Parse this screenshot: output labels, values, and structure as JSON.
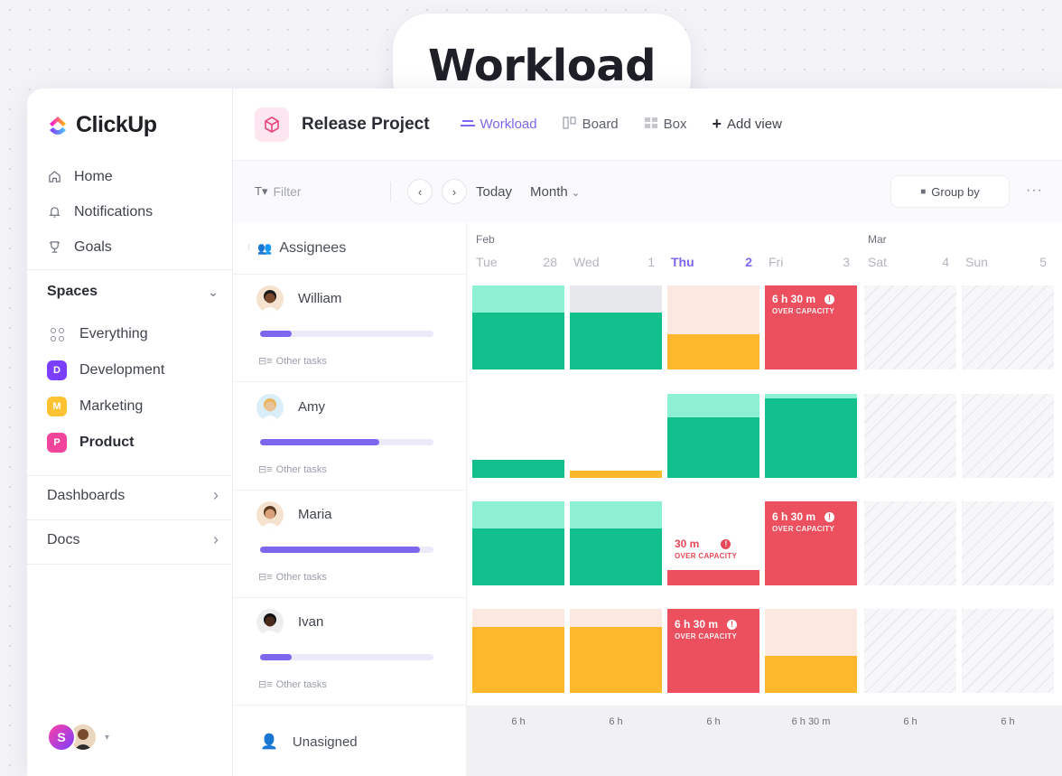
{
  "headline": "Workload",
  "sidebar": {
    "logo": "ClickUp",
    "nav": [
      {
        "label": "Home",
        "icon": "home-icon"
      },
      {
        "label": "Notifications",
        "icon": "bell-icon"
      },
      {
        "label": "Goals",
        "icon": "trophy-icon"
      }
    ],
    "spaces_label": "Spaces",
    "spaces": [
      {
        "label": "Everything",
        "badge": "",
        "color": ""
      },
      {
        "label": "Development",
        "badge": "D",
        "color": "#7b3fff"
      },
      {
        "label": "Marketing",
        "badge": "M",
        "color": "#ffc233"
      },
      {
        "label": "Product",
        "badge": "P",
        "color": "#f0459a"
      }
    ],
    "dashboards": "Dashboards",
    "docs": "Docs",
    "avatar_initial": "S"
  },
  "header": {
    "project": "Release Project",
    "views": [
      {
        "label": "Workload",
        "icon": "workload-icon",
        "active": true
      },
      {
        "label": "Board",
        "icon": "board-icon",
        "active": false
      },
      {
        "label": "Box",
        "icon": "box-icon",
        "active": false
      },
      {
        "label": "Add view",
        "icon": "plus-icon",
        "active": false
      }
    ]
  },
  "toolbar": {
    "filter_placeholder": "Filter",
    "today": "Today",
    "range": "Month",
    "group_by": "Group by",
    "more": "···"
  },
  "grid": {
    "assignees_header": "Assignees",
    "other_tasks": "Other tasks",
    "unassigned": "Unasigned",
    "days": [
      {
        "month": "Feb",
        "name": "Tue",
        "num": "28",
        "today": false
      },
      {
        "month": "",
        "name": "Wed",
        "num": "1",
        "today": false
      },
      {
        "month": "",
        "name": "Thu",
        "num": "2",
        "today": true
      },
      {
        "month": "",
        "name": "Fri",
        "num": "3",
        "today": false
      },
      {
        "month": "Mar",
        "name": "Sat",
        "num": "4",
        "today": false
      },
      {
        "month": "",
        "name": "Sun",
        "num": "5",
        "today": false
      }
    ],
    "assignees": [
      {
        "name": "William",
        "progress": 0.18
      },
      {
        "name": "Amy",
        "progress": 0.69
      },
      {
        "name": "Maria",
        "progress": 0.92
      },
      {
        "name": "Ivan",
        "progress": 0.18
      }
    ],
    "over_capacity": [
      {
        "time": "6 h 30 m",
        "label": "OVER CAPACITY"
      },
      {
        "time": "6 h 30 m",
        "label": "OVER CAPACITY"
      },
      {
        "time": "30 m",
        "label": "OVER CAPACITY"
      },
      {
        "time": "6 h 30 m",
        "label": "OVER CAPACITY"
      }
    ],
    "totals": [
      "6 h",
      "6 h",
      "6 h",
      "6 h 30 m",
      "6 h",
      "6 h"
    ]
  },
  "colors": {
    "accent": "#7b68ee",
    "green": "#12c08e",
    "green_light": "#8ef0d2",
    "orange": "#ffb72b",
    "peach": "#fbe8e0",
    "red": "#ec4f5d"
  }
}
